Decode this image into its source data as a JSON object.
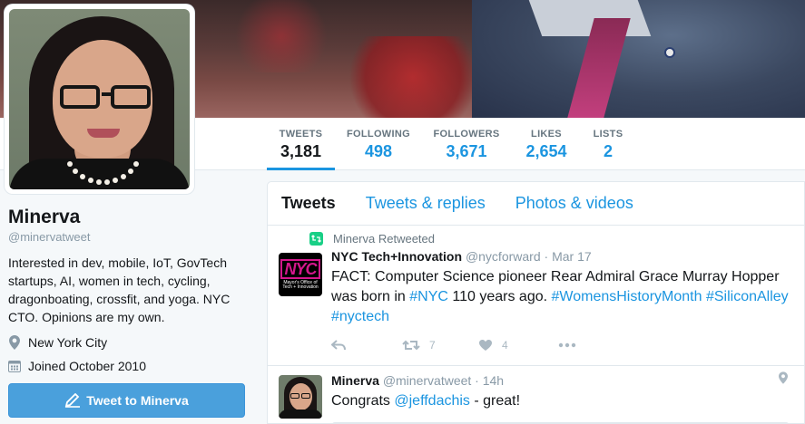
{
  "profile": {
    "name": "Minerva",
    "handle": "@minervatweet",
    "bio": "Interested in dev, mobile, IoT, GovTech startups, AI, women in tech, cycling, dragonboating, crossfit, and yoga. NYC CTO. Opinions are my own.",
    "location": "New York City",
    "joined": "Joined October 2010",
    "tweet_to_label": "Tweet to Minerva"
  },
  "stats": [
    {
      "label": "TWEETS",
      "value": "3,181"
    },
    {
      "label": "FOLLOWING",
      "value": "498"
    },
    {
      "label": "FOLLOWERS",
      "value": "3,671"
    },
    {
      "label": "LIKES",
      "value": "2,654"
    },
    {
      "label": "LISTS",
      "value": "2"
    }
  ],
  "timeline_tabs": [
    "Tweets",
    "Tweets & replies",
    "Photos & videos"
  ],
  "tweets": [
    {
      "retweet_context": "Minerva Retweeted",
      "author_name": "NYC Tech+Innovation",
      "author_handle": "@nycforward",
      "date": "· Mar 17",
      "avatar_text_big": "NYC",
      "avatar_text_small": "Mayor's Office of Tech + Innovation",
      "text_part1": "FACT: Computer Science pioneer Rear Admiral Grace Murray Hopper was born in ",
      "tag_nyc": "#NYC",
      "text_part2": " 110 years ago. ",
      "tag_whm": "#WomensHistoryMonth",
      "tag_sa": "#SiliconAlley",
      "tag_nyctech": "#nyctech",
      "retweets": "7",
      "likes": "4"
    },
    {
      "author_name": "Minerva",
      "author_handle": "@minervatweet",
      "date": "· 14h",
      "text_part1": "Congrats ",
      "mention": "@jeffdachis",
      "text_part2": " - great!"
    }
  ],
  "colors": {
    "accent": "#1b95e0",
    "retweet": "#19cf86",
    "button": "#4aa0dc"
  },
  "icons": [
    "location-pin-icon",
    "calendar-icon",
    "compose-icon",
    "retweet-icon",
    "reply-icon",
    "heart-icon",
    "more-icon"
  ]
}
